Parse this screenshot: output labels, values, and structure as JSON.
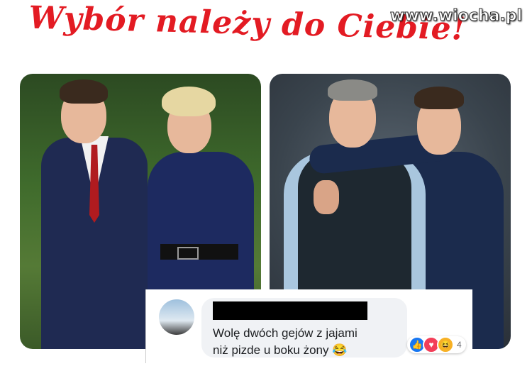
{
  "headline": "Wybór należy do Ciebie!",
  "watermark": "www.wiocha.pl",
  "comment": {
    "text_line1": "Wolę dwóch gejów z jajami",
    "text_line2": "niż pizde u boku żony",
    "emoji": "😂",
    "reaction_count": "4"
  },
  "icons": {
    "like": "👍",
    "love": "♥",
    "haha": "😆"
  },
  "colors": {
    "headline": "#e31b23",
    "like": "#1877f2",
    "love": "#f33e58",
    "haha": "#f7b125"
  }
}
